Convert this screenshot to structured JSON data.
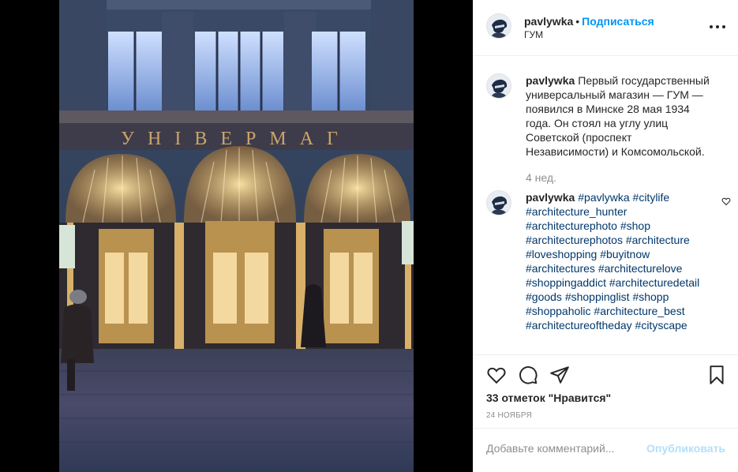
{
  "post": {
    "username": "pavlywka",
    "follow_label": "Подписаться",
    "location": "ГУМ",
    "caption": "Первый государственный универсальный магазин — ГУМ — появился в Минске 28 мая 1934 года. Он стоял на углу улиц Советской (проспект Независимости) и Комсомольской.",
    "caption_time": "4 нед.",
    "comment_username": "pavlywka",
    "hashtags": [
      "#pavlywka",
      "#citylife",
      "#architecture_hunter",
      "#architecturephoto",
      "#shop",
      "#architecturephotos",
      "#architecture",
      "#loveshopping",
      "#buyitnow",
      "#architectures",
      "#architecturelove",
      "#shoppingaddict",
      "#architecturedetail",
      "#goods",
      "#shoppinglist",
      "#shopp",
      "#shoppaholic",
      "#architecture_best",
      "#architectureoftheday",
      "#cityscape"
    ],
    "likes": "33 отметок \"Нравится\"",
    "date": "24 НОЯБРЯ",
    "comment_placeholder": "Добавьте комментарий...",
    "post_button": "Опубликовать",
    "sign_text": "УНІВЕРМАГ"
  },
  "colors": {
    "link": "#00376b",
    "follow": "#0095f6",
    "post_disabled": "#b2dffc"
  },
  "icons": [
    "more-icon",
    "heart-icon",
    "comment-icon",
    "share-icon",
    "bookmark-icon"
  ]
}
